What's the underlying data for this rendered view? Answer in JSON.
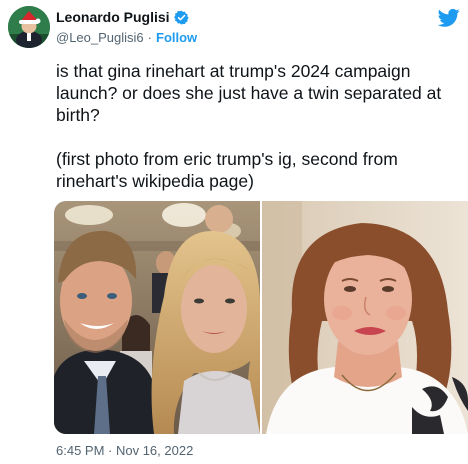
{
  "author": {
    "display_name": "Leonardo Puglisi",
    "handle": "@Leo_Puglisi6",
    "separator": "·",
    "follow_label": "Follow"
  },
  "tweet": {
    "paragraph_1": "is that gina rinehart at trump's 2024 campaign launch? or does she just have a twin separated at birth?",
    "paragraph_2": "(first photo from eric trump's ig, second from rinehart's wikipedia page)"
  },
  "timestamp": "6:45 PM · Nov 16, 2022",
  "colors": {
    "accent": "#1d9bf0",
    "text": "#0f1419",
    "secondary_text": "#536471"
  },
  "icons": {
    "verified": "verified-badge-icon",
    "brand": "twitter-bird-icon"
  }
}
